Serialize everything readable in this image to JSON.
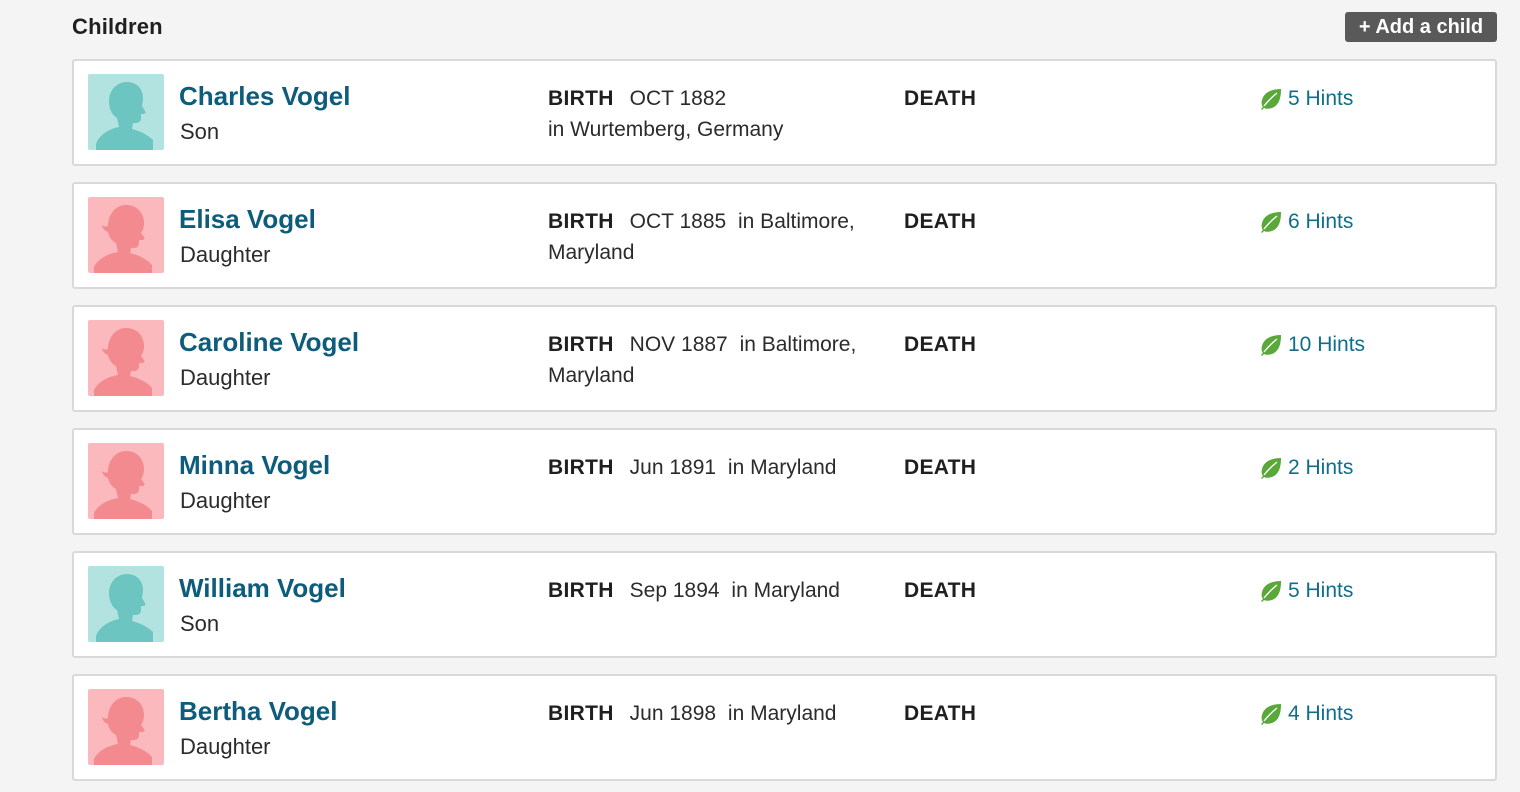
{
  "section": {
    "title": "Children",
    "add_button": "+ Add a child"
  },
  "children": [
    {
      "name": "Charles Vogel",
      "relation": "Son",
      "gender": "male",
      "birth_label": "BIRTH",
      "birth_date": "OCT 1882",
      "birth_place": " in Wurtemberg, Germany",
      "death_label": "DEATH",
      "hints": "5 Hints"
    },
    {
      "name": "Elisa Vogel",
      "relation": "Daughter",
      "gender": "female",
      "birth_label": "BIRTH",
      "birth_date": "OCT 1885",
      "birth_place": " in Baltimore, Maryland",
      "death_label": "DEATH",
      "hints": "6 Hints"
    },
    {
      "name": "Caroline Vogel",
      "relation": "Daughter",
      "gender": "female",
      "birth_label": "BIRTH",
      "birth_date": "NOV 1887",
      "birth_place": " in Baltimore, Maryland",
      "death_label": "DEATH",
      "hints": "10 Hints"
    },
    {
      "name": "Minna Vogel",
      "relation": "Daughter",
      "gender": "female",
      "birth_label": "BIRTH",
      "birth_date": "Jun 1891",
      "birth_place": " in Maryland",
      "death_label": "DEATH",
      "hints": "2 Hints"
    },
    {
      "name": "William Vogel",
      "relation": "Son",
      "gender": "male",
      "birth_label": "BIRTH",
      "birth_date": "Sep 1894",
      "birth_place": " in Maryland",
      "death_label": "DEATH",
      "hints": "5 Hints"
    },
    {
      "name": "Bertha Vogel",
      "relation": "Daughter",
      "gender": "female",
      "birth_label": "BIRTH",
      "birth_date": "Jun 1898",
      "birth_place": " in Maryland",
      "death_label": "DEATH",
      "hints": "4 Hints"
    }
  ],
  "colors": {
    "name_link": "#0e5c7b",
    "hint_link": "#0e6e8b",
    "leaf": "#5aa83a",
    "male_avatar_bg": "#b3e3e1",
    "male_avatar_fg": "#6cc5c1",
    "female_avatar_bg": "#fbb9bd",
    "female_avatar_fg": "#f28a8f",
    "add_button_bg": "#595959"
  },
  "icons": {
    "male_avatar": "male-silhouette-icon",
    "female_avatar": "female-silhouette-icon",
    "hints": "leaf-icon"
  }
}
